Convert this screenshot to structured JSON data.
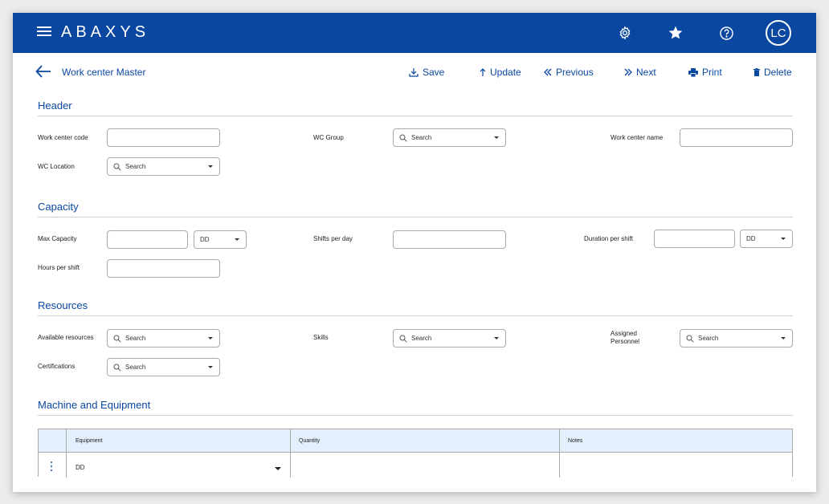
{
  "app": {
    "logo": "ABAXYS",
    "avatar_initials": "LC"
  },
  "topbar_icons": [
    "settings-icon",
    "star-icon",
    "help-icon"
  ],
  "page": {
    "title": "Work center Master"
  },
  "actions": {
    "save": "Save",
    "update": "Update",
    "previous": "Previous",
    "next": "Next",
    "print": "Print",
    "delete": "Delete"
  },
  "sections": {
    "header": {
      "title": "Header",
      "work_center_code_label": "Work center code",
      "wc_group_label": "WC Group",
      "wc_group_placeholder": "Search",
      "work_center_name_label": "Work center name",
      "wc_location_label": "WC Location",
      "wc_location_placeholder": "Search"
    },
    "capacity": {
      "title": "Capacity",
      "max_capacity_label": "Max Capacity",
      "max_capacity_unit": "DD",
      "shifts_per_day_label": "Shifts per day",
      "duration_per_shift_label": "Duration per shift",
      "duration_unit": "DD",
      "hours_per_shift_label": "Hours per shift"
    },
    "resources": {
      "title": "Resources",
      "available_resources_label": "Available resources",
      "available_resources_placeholder": "Search",
      "skills_label": "Skills",
      "skills_placeholder": "Search",
      "assigned_personnel_label_line1": "Assigned",
      "assigned_personnel_label_line2": "Personnel",
      "assigned_personnel_placeholder": "Search",
      "certifications_label": "Certifications",
      "certifications_placeholder": "Search"
    },
    "machine_equipment": {
      "title": "Machine and Equipment",
      "columns": [
        "Equipment",
        "Quantity",
        "Notes"
      ],
      "rows": [
        {
          "equipment": "DD",
          "quantity": "",
          "notes": ""
        }
      ]
    }
  },
  "colors": {
    "brand": "#0a47a0",
    "table_header": "#e3effc"
  }
}
